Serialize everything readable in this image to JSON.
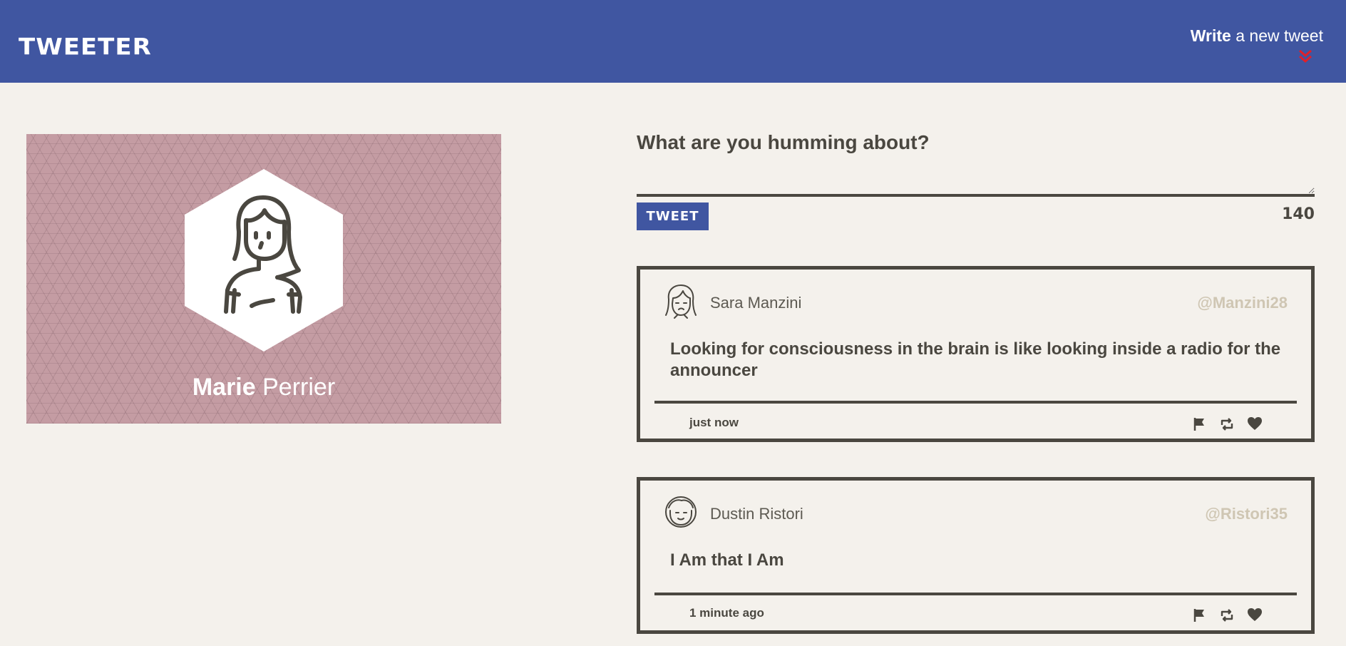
{
  "nav": {
    "brand": "TWEETER",
    "compose_toggle": {
      "bold": "Write",
      "rest": " a new tweet"
    },
    "chevron_icon": "double-chevron-down-icon",
    "chevron_color": "#e0202a"
  },
  "profile": {
    "first_name": "Marie",
    "last_name": " Perrier",
    "avatar_icon": "woman-avatar-icon",
    "banner_color": "#c49ca3"
  },
  "compose": {
    "label": "What are you humming about?",
    "input_value": "",
    "button_label": "TWEET",
    "counter": "140"
  },
  "tweets": [
    {
      "avatar_icon": "woman-avatar-icon",
      "name": "Sara Manzini",
      "handle": "@Manzini28",
      "content": "Looking for consciousness in the brain is like looking inside a radio for the announcer",
      "time": "just now",
      "actions": [
        "flag-icon",
        "retweet-icon",
        "heart-icon"
      ]
    },
    {
      "avatar_icon": "man-avatar-icon",
      "name": "Dustin Ristori",
      "handle": "@Ristori35",
      "content": "I Am that I Am",
      "time": "1 minute ago",
      "actions": [
        "flag-icon",
        "retweet-icon",
        "heart-icon"
      ]
    }
  ],
  "colors": {
    "nav": "#4056a1",
    "background": "#f4f1ec",
    "text": "#4a4740",
    "handle": "#cfc6b3"
  }
}
